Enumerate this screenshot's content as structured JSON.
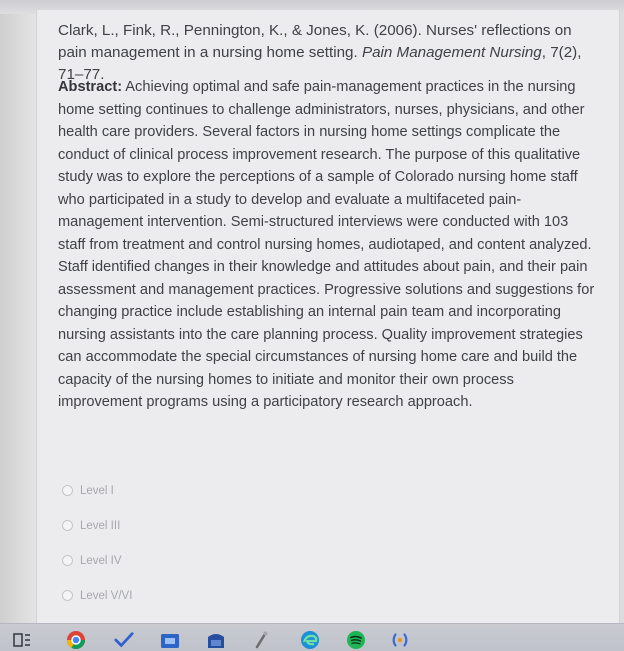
{
  "citation": {
    "authors_year_title": "Clark, L., Fink, R., Pennington, K., & Jones, K. (2006). Nurses' reflections on pain management in a nursing home setting. ",
    "journal": "Pain Management Nursing",
    "volume_pages": ", 7(2), 71–77."
  },
  "abstract": {
    "label": "Abstract:",
    "text": " Achieving optimal and safe pain-management practices in the nursing home setting continues to challenge administrators, nurses, physicians, and other health care providers. Several factors in nursing home settings complicate the conduct of clinical process improvement research. The purpose of this qualitative study was to explore the perceptions of a sample of Colorado nursing home staff who participated in a study to develop and evaluate a multifaceted pain-management intervention. Semi-structured interviews were conducted with 103 staff from treatment and control nursing homes, audiotaped, and content analyzed. Staff identified changes in their knowledge and attitudes about pain, and their pain assessment and management practices. Progressive solutions and suggestions for changing practice include establishing an internal pain team and incorporating nursing assistants into the care planning process. Quality improvement strategies can accommodate the special circumstances of nursing home care and build the capacity of the nursing homes to initiate and monitor their own process improvement programs using a participatory research approach."
  },
  "options": [
    {
      "label": "Level I"
    },
    {
      "label": "Level III"
    },
    {
      "label": "Level IV"
    },
    {
      "label": "Level V/VI"
    }
  ],
  "taskbar": {
    "icons": [
      "task-view-icon",
      "chrome-icon",
      "check-icon",
      "file-explorer-icon",
      "microsoft-store-icon",
      "pen-icon",
      "edge-icon",
      "spotify-icon",
      "sync-icon"
    ]
  },
  "colors": {
    "panel_bg": "#ececee",
    "text": "#3f4146",
    "option_text": "#a6a8ac"
  }
}
